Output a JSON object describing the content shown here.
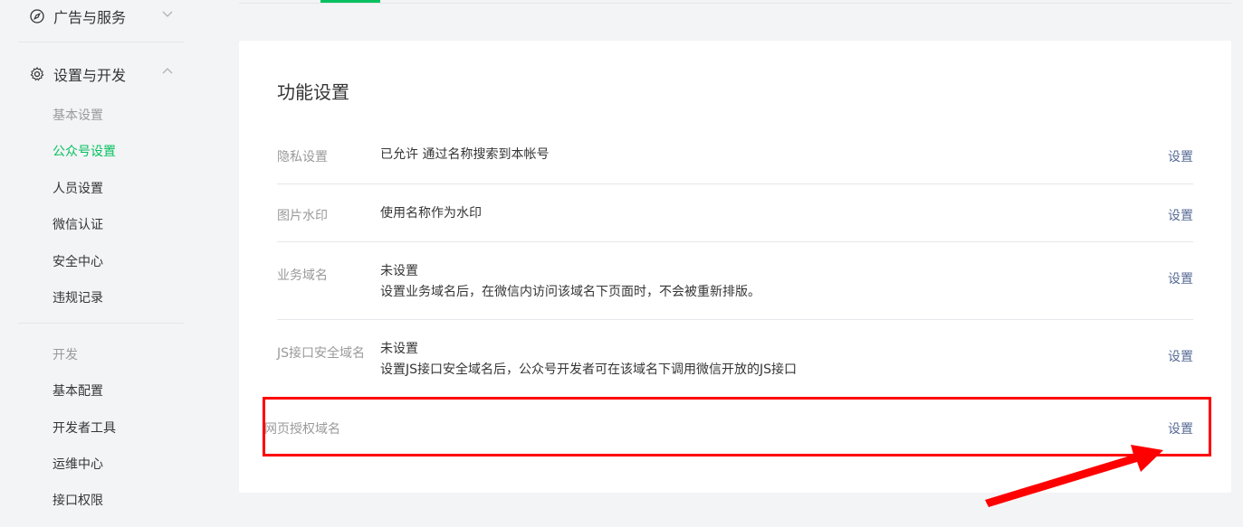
{
  "sidebar": {
    "groups": [
      {
        "label": "广告与服务"
      },
      {
        "label": "设置与开发"
      }
    ],
    "items": [
      {
        "label": "基本设置"
      },
      {
        "label": "公众号设置"
      },
      {
        "label": "人员设置"
      },
      {
        "label": "微信认证"
      },
      {
        "label": "安全中心"
      },
      {
        "label": "违规记录"
      }
    ],
    "dev_section": "开发",
    "dev_items": [
      {
        "label": "基本配置"
      },
      {
        "label": "开发者工具"
      },
      {
        "label": "运维中心"
      },
      {
        "label": "接口权限"
      }
    ]
  },
  "main": {
    "title": "功能设置",
    "rows": [
      {
        "label": "隐私设置",
        "value_1": "已允许 通过名称搜索到本帐号",
        "action": "设置"
      },
      {
        "label": "图片水印",
        "value_1": "使用名称作为水印",
        "action": "设置"
      },
      {
        "label": "业务域名",
        "value_1": "未设置",
        "value_2": "设置业务域名后，在微信内访问该域名下页面时，不会被重新排版。",
        "action": "设置"
      },
      {
        "label": "JS接口安全域名",
        "value_1": "未设置",
        "value_2": "设置JS接口安全域名后，公众号开发者可在该域名下调用微信开放的JS接口",
        "action": "设置"
      },
      {
        "label": "网页授权域名",
        "action": "设置"
      }
    ]
  },
  "colors": {
    "accent": "#07c160",
    "link": "#576b95",
    "annotation": "#ff0000"
  },
  "icons": [
    "compass-icon",
    "gear-icon",
    "chevron-down-icon",
    "chevron-up-icon",
    "annotation-arrow-icon"
  ]
}
